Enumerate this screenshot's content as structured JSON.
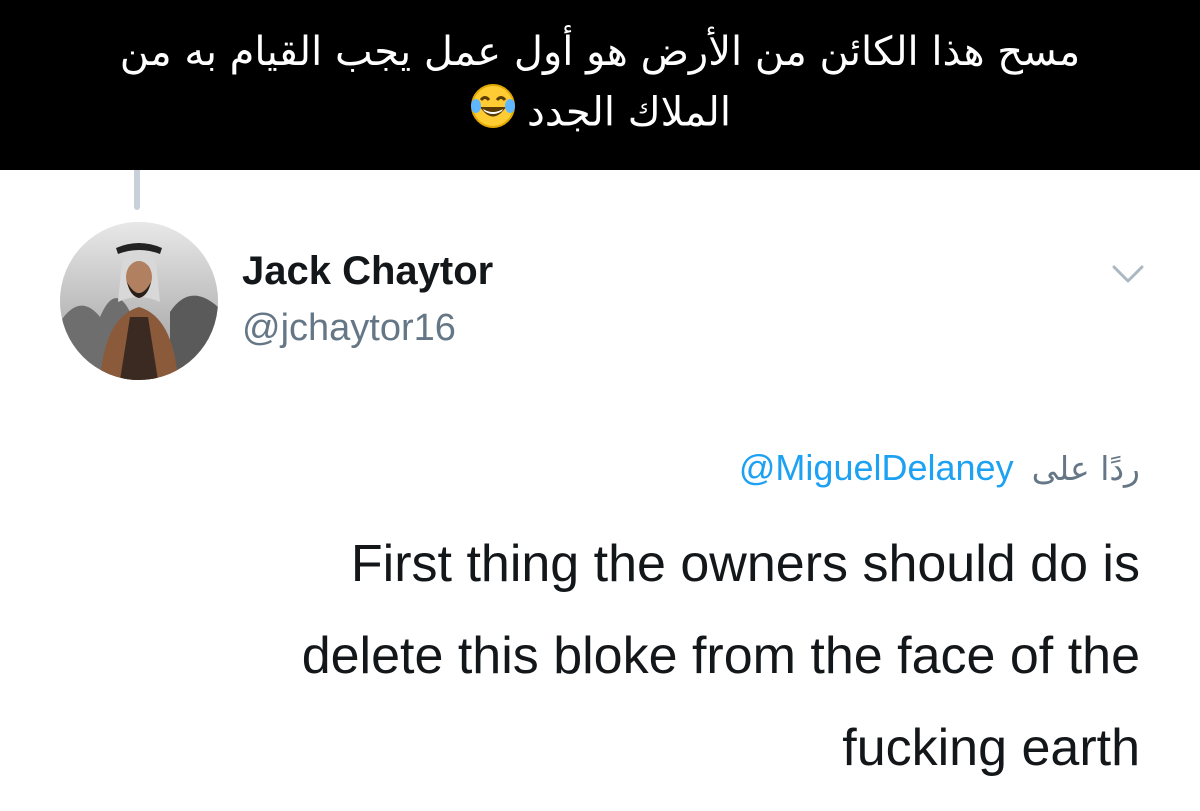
{
  "caption": {
    "line1": "مسح هذا الكائن من الأرض هو أول عمل يجب القيام به من",
    "line2": "الملاك الجدد",
    "emoji_icon": "face-with-tears-of-joy-icon"
  },
  "tweet": {
    "author": {
      "display_name": "Jack Chaytor",
      "handle": "@jchaytor16",
      "avatar_icon": "profile-avatar"
    },
    "reply_to": {
      "label": "ردًا على",
      "mention": "@MiguelDelaney"
    },
    "body_lines": [
      "First thing the owners should do is",
      "delete this bloke from the face of the",
      "fucking earth"
    ],
    "menu_icon": "chevron-down-icon"
  },
  "colors": {
    "caption_background": "#000000",
    "caption_text": "#ffffff",
    "link_blue": "#1da1f2",
    "secondary_gray": "#657786",
    "primary_text": "#14171a",
    "thread_line": "#c8d1d9"
  }
}
